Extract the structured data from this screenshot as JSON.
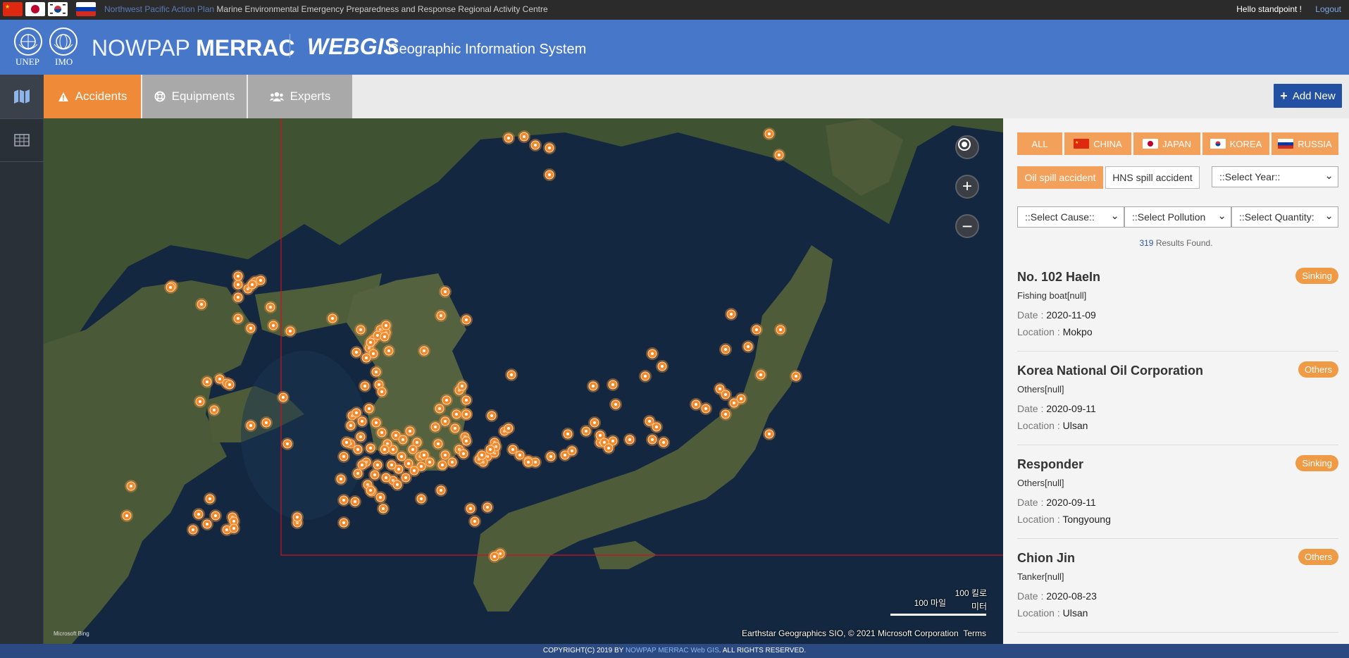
{
  "top_bar": {
    "tagline_highlight": "Northwest Pacific Action Plan",
    "tagline_rest": "Marine Environmental Emergency Preparedness and Response Regional Activity Centre",
    "greeting": "Hello standpoint !",
    "logout": "Logout"
  },
  "header": {
    "emblem_left": "UNEP",
    "emblem_right": "IMO",
    "brand_light": "NOWPAP",
    "brand_bold": "MERRAC",
    "product": "WEBGIS",
    "product_sub": "Geographic Information System"
  },
  "tabs": {
    "accidents": "Accidents",
    "equipments": "Equipments",
    "experts": "Experts",
    "add_new": "Add New"
  },
  "map": {
    "attribution": "Earthstar Geographics SIO, © 2021 Microsoft Corporation",
    "terms": "Terms",
    "provider": "Microsoft Bing",
    "scale_miles": "100 마일",
    "scale_km_1": "100 킬로",
    "scale_km_2": "미터",
    "colors": {
      "land": "#4a5a38",
      "sea": "#142a44",
      "marker": "#f08a2c",
      "frame": "#d01020"
    }
  },
  "filters": {
    "countries": [
      "ALL",
      "CHINA",
      "JAPAN",
      "KOREA",
      "RUSSIA"
    ],
    "accident_types": [
      "Oil spill accident",
      "HNS spill accident"
    ],
    "year_select": "::Select Year::",
    "cause_select": "::Select Cause::",
    "pollution_select": "::Select Pollution",
    "quantity_select": "::Select Quantity:"
  },
  "results": {
    "count": "319",
    "suffix": "Results Found."
  },
  "labels": {
    "date": "Date :",
    "location": "Location :"
  },
  "accidents": [
    {
      "name": "No. 102 HaeIn",
      "badge": "Sinking",
      "type": "Fishing boat[null]",
      "date": "2020-11-09",
      "location": "Mokpo"
    },
    {
      "name": "Korea National Oil Corporation",
      "badge": "Others",
      "type": "Others[null]",
      "date": "2020-09-11",
      "location": "Ulsan"
    },
    {
      "name": "Responder",
      "badge": "Sinking",
      "type": "Others[null]",
      "date": "2020-09-11",
      "location": "Tongyoung"
    },
    {
      "name": "Chion Jin",
      "badge": "Others",
      "type": "Tanker[null]",
      "date": "2020-08-23",
      "location": "Ulsan"
    }
  ],
  "footer": {
    "prefix": "COPYRIGHT(C) 2019 BY",
    "link": "NOWPAP MERRAC Web GIS",
    "suffix": ". ALL RIGHTS RESERVED."
  }
}
